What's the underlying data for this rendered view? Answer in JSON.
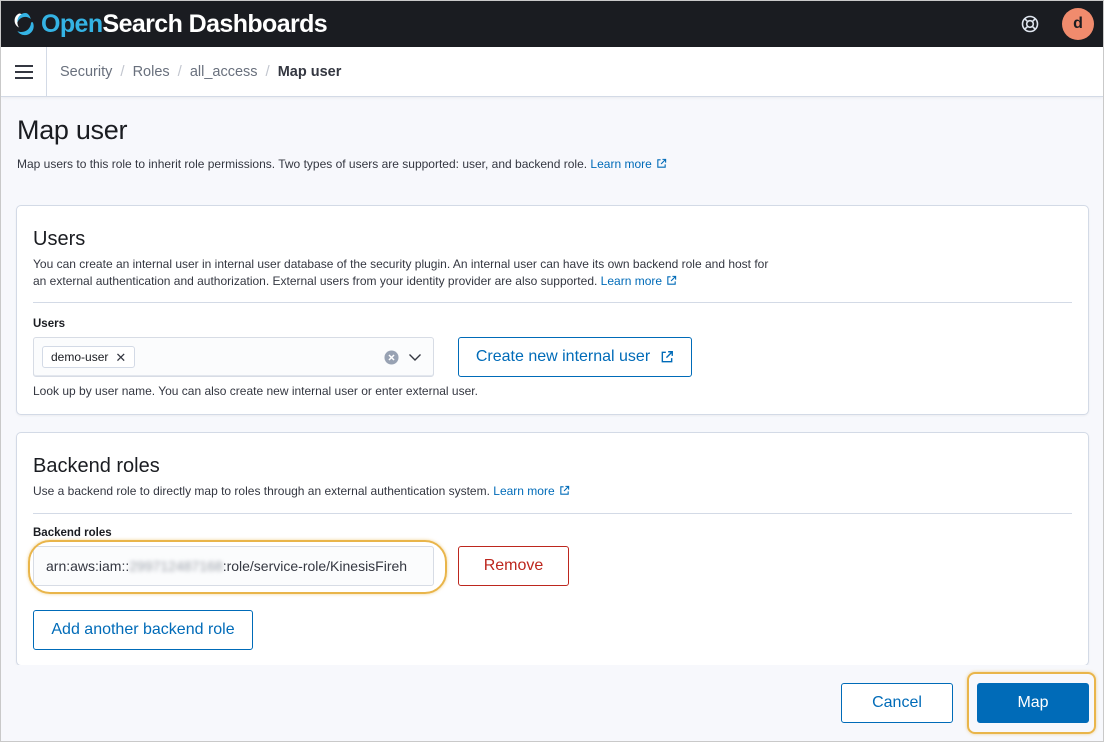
{
  "app": {
    "logo_open": "Open",
    "logo_rest": "Search Dashboards",
    "avatar_initial": "d"
  },
  "breadcrumbs": [
    {
      "label": "Security"
    },
    {
      "label": "Roles"
    },
    {
      "label": "all_access"
    },
    {
      "label": "Map user"
    }
  ],
  "page": {
    "title": "Map user",
    "description": "Map users to this role to inherit role permissions. Two types of users are supported: user, and backend role.",
    "learn_more": "Learn more"
  },
  "users_panel": {
    "title": "Users",
    "description_line1": "You can create an internal user in internal user database of the security plugin. An internal user can have its own backend role and host for",
    "description_line2": "an external authentication and authorization. External users from your identity provider are also supported.",
    "learn_more": "Learn more",
    "field_label": "Users",
    "selected_user": "demo-user",
    "help_text": "Look up by user name. You can also create new internal user or enter external user.",
    "create_button": "Create new internal user"
  },
  "backend_panel": {
    "title": "Backend roles",
    "description": "Use a backend role to directly map to roles through an external authentication system.",
    "learn_more": "Learn more",
    "field_label": "Backend roles",
    "value_prefix": "arn:aws:iam::",
    "value_redacted": "299712487168",
    "value_suffix": ":role/service-role/KinesisFireh",
    "remove_button": "Remove",
    "add_button": "Add another backend role"
  },
  "footer": {
    "cancel_button": "Cancel",
    "map_button": "Map"
  },
  "colors": {
    "header_bg": "#1a1c21",
    "primary": "#006bb8",
    "danger": "#bd271e",
    "highlight": "#e9b54a",
    "avatar_bg": "#f08b6d"
  }
}
